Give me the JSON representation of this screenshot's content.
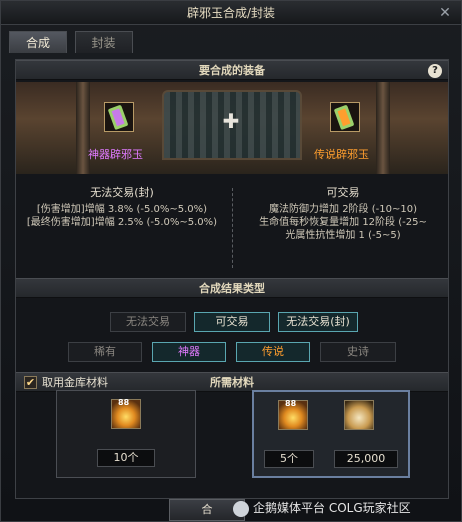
{
  "window": {
    "title": "辟邪玉合成/封装"
  },
  "tabs": [
    {
      "label": "合成",
      "active": true
    },
    {
      "label": "封装",
      "active": false
    }
  ],
  "equipment_section": {
    "title": "要合成的装备",
    "left_item": {
      "name": "神器辟邪玉",
      "color": "#e07aff"
    },
    "right_item": {
      "name": "传说辟邪玉",
      "color": "#ff9e2e"
    },
    "left_props": {
      "head": "无法交易(封)",
      "lines": [
        "[伤害增加]增幅 3.8% (-5.0%~5.0%)",
        "[最终伤害增加]增幅 2.5% (-5.0%~5.0%)"
      ]
    },
    "right_props": {
      "head": "可交易",
      "lines": [
        "魔法防御力增加 2阶段 (-10~10)",
        "生命值每秒恢复量增加 12阶段 (-25~",
        "光属性抗性增加 1 (-5~5)"
      ]
    }
  },
  "result_section": {
    "title": "合成结果类型",
    "trade_options": [
      {
        "label": "无法交易",
        "color": "#8a8680",
        "selected": false
      },
      {
        "label": "可交易",
        "color": "#e8e2d2",
        "selected": true
      },
      {
        "label": "无法交易(封)",
        "color": "#e8e2d2",
        "selected": true
      }
    ],
    "rarity_options": [
      {
        "label": "稀有",
        "color": "#8a8680",
        "selected": false
      },
      {
        "label": "神器",
        "color": "#e07aff",
        "selected": true
      },
      {
        "label": "传说",
        "color": "#ff9e2e",
        "selected": true
      },
      {
        "label": "史诗",
        "color": "#8a8680",
        "selected": false
      }
    ]
  },
  "materials_section": {
    "checkbox_label": "取用金库材料",
    "checked": true,
    "title": "所需材料",
    "option_a": {
      "badge": "88",
      "count": "10个"
    },
    "option_b": {
      "badge": "88",
      "count": "5个",
      "gold": "25,000"
    }
  },
  "footer": {
    "button_label": "合",
    "watermark": "企鹅媒体平台 COLG玩家社区"
  }
}
